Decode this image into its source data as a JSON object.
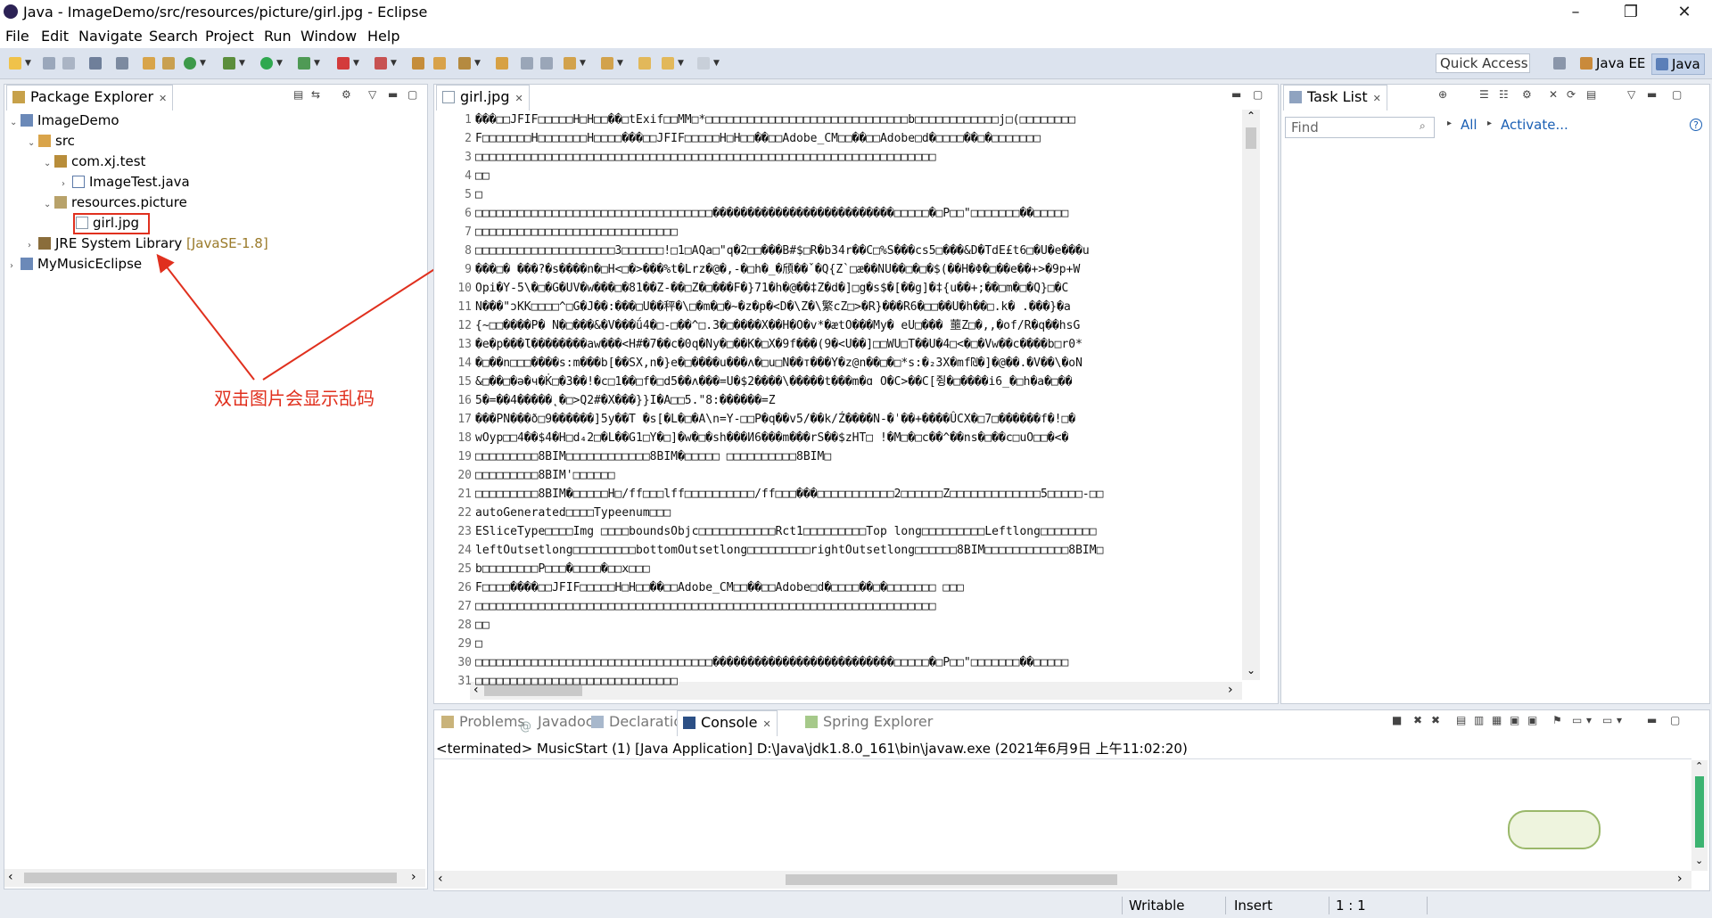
{
  "window": {
    "title": "Java - ImageDemo/src/resources/picture/girl.jpg - Eclipse",
    "minimize_glyph": "–",
    "restore_glyph": "❐",
    "close_glyph": "✕"
  },
  "menu": [
    "File",
    "Edit",
    "Navigate",
    "Search",
    "Project",
    "Run",
    "Window",
    "Help"
  ],
  "toolbar": {
    "quick_access_placeholder": "Quick Access",
    "perspectives": [
      "Java EE",
      "Java"
    ]
  },
  "package_explorer": {
    "tab_label": "Package Explorer",
    "tree": [
      {
        "label": "ImageDemo",
        "suffix": "",
        "twisty": "⌄"
      },
      {
        "label": "src",
        "suffix": "",
        "twisty": "⌄"
      },
      {
        "label": "com.xj.test",
        "suffix": "",
        "twisty": "⌄"
      },
      {
        "label": "ImageTest.java",
        "suffix": "",
        "twisty": "›"
      },
      {
        "label": "resources.picture",
        "suffix": "",
        "twisty": "⌄"
      },
      {
        "label": "girl.jpg",
        "suffix": "",
        "twisty": ""
      },
      {
        "label": "JRE System Library",
        "suffix": "[JavaSE-1.8]",
        "twisty": "›"
      },
      {
        "label": "MyMusicEclipse",
        "suffix": "",
        "twisty": "›"
      }
    ]
  },
  "annotation": {
    "text": "双击图片会显示乱码",
    "color": "#e0301e"
  },
  "editor": {
    "tab_label": "girl.jpg",
    "lines": [
      {
        "n": "1",
        "text": "���□□JFIF□□□□□H□H□□��□tExif□□MM□*□□□□□□□□□□□□□□□□□□□□□□□□□□□□□b□□□□□□□□□□□□j□(□□□□□□□□"
      },
      {
        "n": "2",
        "text": "F□□□□□□□H□□□□□□□H□□□□���□□JFIF□□□□□H□H□□��□□Adobe_CM□□��□□Adobe□d�□□□□��□�□□□□□□□"
      },
      {
        "n": "3",
        "text": "□□□□□□□□□□□□□□□□□□□□□□□□□□□□□□□□□□□□□□□□□□□□□□□□□□□□□□□□□□□□□□□□□□"
      },
      {
        "n": "4",
        "text": "□□"
      },
      {
        "n": "5",
        "text": "□"
      },
      {
        "n": "6",
        "text": "□□□□□□□□□□□□□□□□□□□□□□□□□□□□□□□□□□��������������������������□□□□□�□P□□\"□□□□□□□��□□□□□"
      },
      {
        "n": "7",
        "text": "□□□□□□□□□□□□□□□□□□□□□□□□□□□□□"
      },
      {
        "n": "8",
        "text": "□□□□□□□□□□□□□□□□□□□□3□□□□□□!□1□AQa□\"q�2□□���B#$□R�b34r��C□%S���cs5□���&D�TdE£t6□�U�e���u"
      },
      {
        "n": "9",
        "text": "���□� ���?�s����n�□H<□�>���%t�Lrz�@�,-�□h�_�頎��ˇ�Q{Z`□æ��NU��□�□�$(��H�Φ�□��e��+>�9p+W"
      },
      {
        "n": "10",
        "text": "Opi�Y-5\\�□�G�UV�w���□�81��Z-��□Z�□���F�}71�h�@��‡Z�d�]□g�s$�[��g]�‡{u��+;��□m�□�Q}□�C"
      },
      {
        "n": "11",
        "text": "N���\"ɔKK□□□□^□G�J��:���□U��秤�\\□�m�□�~�z�p�<D�\\Z�\\繁cZ□>�R}���R6�□□��U�h��□.k� .���}�a"
      },
      {
        "n": "12",
        "text": "{~□□����P� N�□���&�V���ǘ4�□-□��^□.3�□����X��H�O�v*�ætO���My� eU□��� 蘁Z□�,,�of/R�q��hsG"
      },
      {
        "n": "13",
        "text": "�e�p���Ɩ��������aw���<H#�7��c�0q�Ny�□��K�□X�9f���(9�<U��]□□WU□T��U�4□<�□�Vw��c����b□r0*"
      },
      {
        "n": "14",
        "text": "�□��n□□□����s:m���b[��SX,n�}e�□����u���ʌ�□u□N��т���Y�z@n��□�□*s:�₂3X�mf₪�]�@��.�V��\\�oN"
      },
      {
        "n": "15",
        "text": "&□��□�ə�ч�K̇□�3��!�c□1��□f�□d5��ʌ���=U�$2����\\�����t���m�ɑ O�C>��C[쥥�□����i6_�□h�a�□��"
      },
      {
        "n": "16",
        "text": "5�=��4�����˛�□>Q2#�X���}}I�A□□5.\"8:������=Z"
      },
      {
        "n": "17",
        "text": "���PN���ð□9������]5y��T �s[�L�□�A\\n=Y-□□P�q��v5/��k/Ź����N-�ˈ��+����ÛCX�□7□������f�!□�"
      },
      {
        "n": "18",
        "text": "wOyp□□4��$4�H□d₄2□�L��G1□Y�□]�w�□�sh���И6���m���rS��$zHT□ !�M□�□c��^��ns�□��c□uO□□�<�"
      },
      {
        "n": "19",
        "text": "□□□□□□□□□8BIM□□□□□□□□□□□□8BIM�□□□□□ □□□□□□□□□□8BIM□"
      },
      {
        "n": "20",
        "text": "□□□□□□□□□8BIM'□□□□□□"
      },
      {
        "n": "21",
        "text": "□□□□□□□□□8BIM�□□□□□H□/ff□□□lff□□□□□□□□□□/ff□□□���□□□□□□□□□□□2□□□□□□Z□□□□□□□□□□□□□5□□□□□-□□"
      },
      {
        "n": "22",
        "text": "autoGenerated□□□□Typeenum□□□"
      },
      {
        "n": "23",
        "text": "ESliceType□□□□Img □□□□boundsObjc□□□□□□□□□□□Rct1□□□□□□□□□Top long□□□□□□□□□Leftlong□□□□□□□□"
      },
      {
        "n": "24",
        "text": "leftOutsetlong□□□□□□□□□bottomOutsetlong□□□□□□□□□rightOutsetlong□□□□□□8BIM□□□□□□□□□□□□8BIM□"
      },
      {
        "n": "25",
        "text": "b□□□□□□□□P□□□�□□□□�□□x□□□"
      },
      {
        "n": "26",
        "text": "F□□□□����□□JFIF□□□□□H□H□□��□□Adobe_CM□□��□□Adobe□d�□□□□��□�□□□□□□□      □□□"
      },
      {
        "n": "27",
        "text": "□□□□□□□□□□□□□□□□□□□□□□□□□□□□□□□□□□□□□□□□□□□□□□□□□□□□□□□□□□□□□□□□□□"
      },
      {
        "n": "28",
        "text": "□□"
      },
      {
        "n": "29",
        "text": "□"
      },
      {
        "n": "30",
        "text": "□□□□□□□□□□□□□□□□□□□□□□□□□□□□□□□□□□��������������������������□□□□□�□P□□\"□□□□□□□��□□□□□"
      },
      {
        "n": "31",
        "text": "□□□□□□□□□□□□□□□□□□□□□□□□□□□□□"
      }
    ]
  },
  "task_list": {
    "tab_label": "Task List",
    "find_placeholder": "Find",
    "all_label": "All",
    "activate_label": "Activate..."
  },
  "bottom_panel": {
    "tabs": [
      "Problems",
      "Javadoc",
      "Declaration",
      "Console",
      "Spring Explorer"
    ],
    "active_tab": "Console",
    "console_text": "<terminated> MusicStart (1) [Java Application] D:\\Java\\jdk1.8.0_161\\bin\\javaw.exe (2021年6月9日 上午11:02:20)"
  },
  "statusbar": {
    "writable": "Writable",
    "insert": "Insert",
    "position": "1 : 1"
  },
  "icons": {
    "folder": "folder-icon",
    "package": "package-icon",
    "java-file": "java-file-icon",
    "image-file": "image-file-icon",
    "library": "library-icon"
  }
}
